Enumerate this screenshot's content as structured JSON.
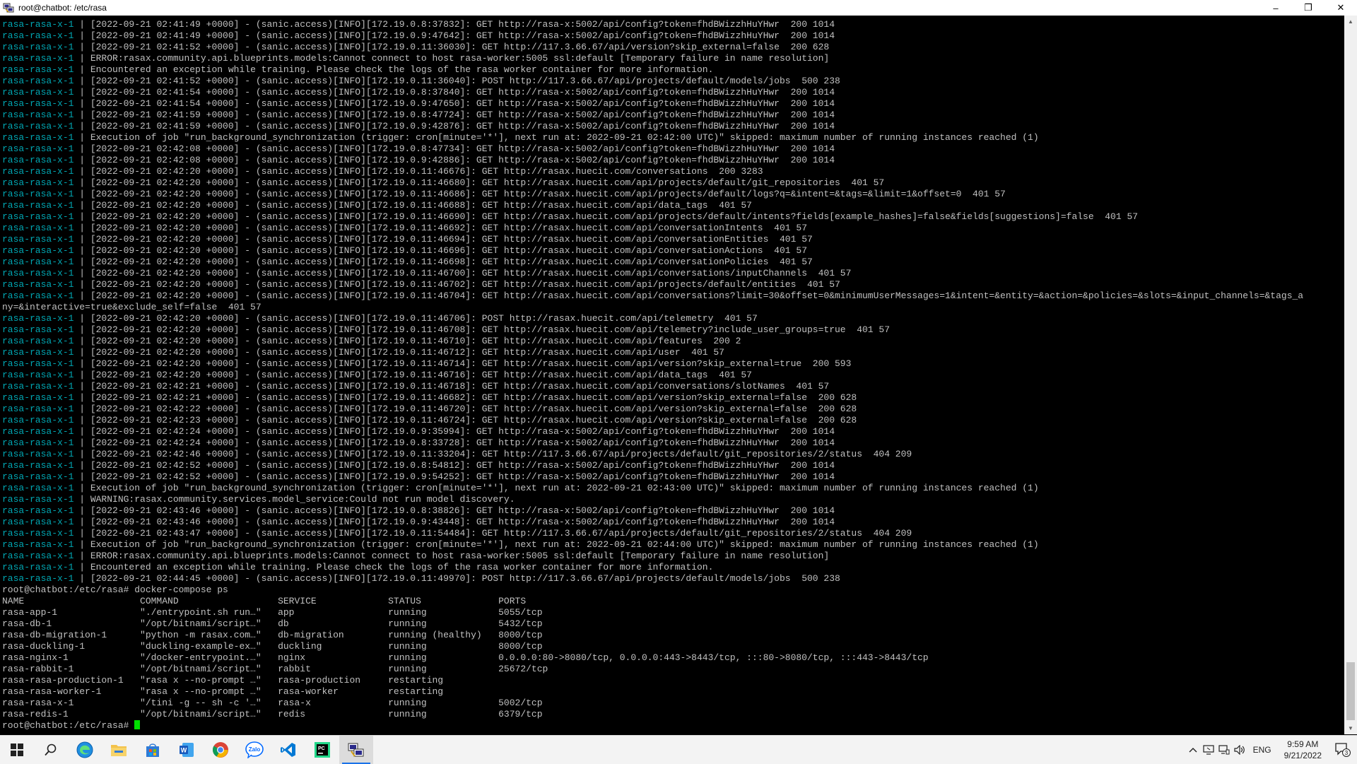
{
  "window": {
    "title": "root@chatbot: /etc/rasa",
    "controls": {
      "minimize": "–",
      "maximize": "❐",
      "close": "✕"
    }
  },
  "terminal": {
    "log_lines": [
      {
        "pfx": "rasa-rasa-x-1",
        "msg": " | [2022-09-21 02:41:49 +0000] - (sanic.access)[INFO][172.19.0.8:37832]: GET http://rasa-x:5002/api/config?token=fhdBWizzhHuYHwr  200 1014"
      },
      {
        "pfx": "rasa-rasa-x-1",
        "msg": " | [2022-09-21 02:41:49 +0000] - (sanic.access)[INFO][172.19.0.9:47642]: GET http://rasa-x:5002/api/config?token=fhdBWizzhHuYHwr  200 1014"
      },
      {
        "pfx": "rasa-rasa-x-1",
        "msg": " | [2022-09-21 02:41:52 +0000] - (sanic.access)[INFO][172.19.0.11:36030]: GET http://117.3.66.67/api/version?skip_external=false  200 628"
      },
      {
        "pfx": "rasa-rasa-x-1",
        "msg": " | ERROR:rasax.community.api.blueprints.models:Cannot connect to host rasa-worker:5005 ssl:default [Temporary failure in name resolution]"
      },
      {
        "pfx": "rasa-rasa-x-1",
        "msg": " | Encountered an exception while training. Please check the logs of the rasa worker container for more information."
      },
      {
        "pfx": "rasa-rasa-x-1",
        "msg": " | [2022-09-21 02:41:52 +0000] - (sanic.access)[INFO][172.19.0.11:36040]: POST http://117.3.66.67/api/projects/default/models/jobs  500 238"
      },
      {
        "pfx": "rasa-rasa-x-1",
        "msg": " | [2022-09-21 02:41:54 +0000] - (sanic.access)[INFO][172.19.0.8:37840]: GET http://rasa-x:5002/api/config?token=fhdBWizzhHuYHwr  200 1014"
      },
      {
        "pfx": "rasa-rasa-x-1",
        "msg": " | [2022-09-21 02:41:54 +0000] - (sanic.access)[INFO][172.19.0.9:47650]: GET http://rasa-x:5002/api/config?token=fhdBWizzhHuYHwr  200 1014"
      },
      {
        "pfx": "rasa-rasa-x-1",
        "msg": " | [2022-09-21 02:41:59 +0000] - (sanic.access)[INFO][172.19.0.8:47724]: GET http://rasa-x:5002/api/config?token=fhdBWizzhHuYHwr  200 1014"
      },
      {
        "pfx": "rasa-rasa-x-1",
        "msg": " | [2022-09-21 02:41:59 +0000] - (sanic.access)[INFO][172.19.0.9:42876]: GET http://rasa-x:5002/api/config?token=fhdBWizzhHuYHwr  200 1014"
      },
      {
        "pfx": "rasa-rasa-x-1",
        "msg": " | Execution of job \"run_background_synchronization (trigger: cron[minute='*'], next run at: 2022-09-21 02:42:00 UTC)\" skipped: maximum number of running instances reached (1)"
      },
      {
        "pfx": "rasa-rasa-x-1",
        "msg": " | [2022-09-21 02:42:08 +0000] - (sanic.access)[INFO][172.19.0.8:47734]: GET http://rasa-x:5002/api/config?token=fhdBWizzhHuYHwr  200 1014"
      },
      {
        "pfx": "rasa-rasa-x-1",
        "msg": " | [2022-09-21 02:42:08 +0000] - (sanic.access)[INFO][172.19.0.9:42886]: GET http://rasa-x:5002/api/config?token=fhdBWizzhHuYHwr  200 1014"
      },
      {
        "pfx": "rasa-rasa-x-1",
        "msg": " | [2022-09-21 02:42:20 +0000] - (sanic.access)[INFO][172.19.0.11:46676]: GET http://rasax.huecit.com/conversations  200 3283"
      },
      {
        "pfx": "rasa-rasa-x-1",
        "msg": " | [2022-09-21 02:42:20 +0000] - (sanic.access)[INFO][172.19.0.11:46680]: GET http://rasax.huecit.com/api/projects/default/git_repositories  401 57"
      },
      {
        "pfx": "rasa-rasa-x-1",
        "msg": " | [2022-09-21 02:42:20 +0000] - (sanic.access)[INFO][172.19.0.11:46686]: GET http://rasax.huecit.com/api/projects/default/logs?q=&intent=&tags=&limit=1&offset=0  401 57"
      },
      {
        "pfx": "rasa-rasa-x-1",
        "msg": " | [2022-09-21 02:42:20 +0000] - (sanic.access)[INFO][172.19.0.11:46688]: GET http://rasax.huecit.com/api/data_tags  401 57"
      },
      {
        "pfx": "rasa-rasa-x-1",
        "msg": " | [2022-09-21 02:42:20 +0000] - (sanic.access)[INFO][172.19.0.11:46690]: GET http://rasax.huecit.com/api/projects/default/intents?fields[example_hashes]=false&fields[suggestions]=false  401 57"
      },
      {
        "pfx": "rasa-rasa-x-1",
        "msg": " | [2022-09-21 02:42:20 +0000] - (sanic.access)[INFO][172.19.0.11:46692]: GET http://rasax.huecit.com/api/conversationIntents  401 57"
      },
      {
        "pfx": "rasa-rasa-x-1",
        "msg": " | [2022-09-21 02:42:20 +0000] - (sanic.access)[INFO][172.19.0.11:46694]: GET http://rasax.huecit.com/api/conversationEntities  401 57"
      },
      {
        "pfx": "rasa-rasa-x-1",
        "msg": " | [2022-09-21 02:42:20 +0000] - (sanic.access)[INFO][172.19.0.11:46696]: GET http://rasax.huecit.com/api/conversationActions  401 57"
      },
      {
        "pfx": "rasa-rasa-x-1",
        "msg": " | [2022-09-21 02:42:20 +0000] - (sanic.access)[INFO][172.19.0.11:46698]: GET http://rasax.huecit.com/api/conversationPolicies  401 57"
      },
      {
        "pfx": "rasa-rasa-x-1",
        "msg": " | [2022-09-21 02:42:20 +0000] - (sanic.access)[INFO][172.19.0.11:46700]: GET http://rasax.huecit.com/api/conversations/inputChannels  401 57"
      },
      {
        "pfx": "rasa-rasa-x-1",
        "msg": " | [2022-09-21 02:42:20 +0000] - (sanic.access)[INFO][172.19.0.11:46702]: GET http://rasax.huecit.com/api/projects/default/entities  401 57"
      },
      {
        "pfx": "rasa-rasa-x-1",
        "msg": " | [2022-09-21 02:42:20 +0000] - (sanic.access)[INFO][172.19.0.11:46704]: GET http://rasax.huecit.com/api/conversations?limit=30&offset=0&minimumUserMessages=1&intent=&entity=&action=&policies=&slots=&input_channels=&tags_a"
      },
      {
        "pfx": "",
        "msg": "ny=&interactive=true&exclude_self=false  401 57"
      },
      {
        "pfx": "rasa-rasa-x-1",
        "msg": " | [2022-09-21 02:42:20 +0000] - (sanic.access)[INFO][172.19.0.11:46706]: POST http://rasax.huecit.com/api/telemetry  401 57"
      },
      {
        "pfx": "rasa-rasa-x-1",
        "msg": " | [2022-09-21 02:42:20 +0000] - (sanic.access)[INFO][172.19.0.11:46708]: GET http://rasax.huecit.com/api/telemetry?include_user_groups=true  401 57"
      },
      {
        "pfx": "rasa-rasa-x-1",
        "msg": " | [2022-09-21 02:42:20 +0000] - (sanic.access)[INFO][172.19.0.11:46710]: GET http://rasax.huecit.com/api/features  200 2"
      },
      {
        "pfx": "rasa-rasa-x-1",
        "msg": " | [2022-09-21 02:42:20 +0000] - (sanic.access)[INFO][172.19.0.11:46712]: GET http://rasax.huecit.com/api/user  401 57"
      },
      {
        "pfx": "rasa-rasa-x-1",
        "msg": " | [2022-09-21 02:42:20 +0000] - (sanic.access)[INFO][172.19.0.11:46714]: GET http://rasax.huecit.com/api/version?skip_external=true  200 593"
      },
      {
        "pfx": "rasa-rasa-x-1",
        "msg": " | [2022-09-21 02:42:20 +0000] - (sanic.access)[INFO][172.19.0.11:46716]: GET http://rasax.huecit.com/api/data_tags  401 57"
      },
      {
        "pfx": "rasa-rasa-x-1",
        "msg": " | [2022-09-21 02:42:21 +0000] - (sanic.access)[INFO][172.19.0.11:46718]: GET http://rasax.huecit.com/api/conversations/slotNames  401 57"
      },
      {
        "pfx": "rasa-rasa-x-1",
        "msg": " | [2022-09-21 02:42:21 +0000] - (sanic.access)[INFO][172.19.0.11:46682]: GET http://rasax.huecit.com/api/version?skip_external=false  200 628"
      },
      {
        "pfx": "rasa-rasa-x-1",
        "msg": " | [2022-09-21 02:42:22 +0000] - (sanic.access)[INFO][172.19.0.11:46720]: GET http://rasax.huecit.com/api/version?skip_external=false  200 628"
      },
      {
        "pfx": "rasa-rasa-x-1",
        "msg": " | [2022-09-21 02:42:23 +0000] - (sanic.access)[INFO][172.19.0.11:46724]: GET http://rasax.huecit.com/api/version?skip_external=false  200 628"
      },
      {
        "pfx": "rasa-rasa-x-1",
        "msg": " | [2022-09-21 02:42:24 +0000] - (sanic.access)[INFO][172.19.0.9:35994]: GET http://rasa-x:5002/api/config?token=fhdBWizzhHuYHwr  200 1014"
      },
      {
        "pfx": "rasa-rasa-x-1",
        "msg": " | [2022-09-21 02:42:24 +0000] - (sanic.access)[INFO][172.19.0.8:33728]: GET http://rasa-x:5002/api/config?token=fhdBWizzhHuYHwr  200 1014"
      },
      {
        "pfx": "rasa-rasa-x-1",
        "msg": " | [2022-09-21 02:42:46 +0000] - (sanic.access)[INFO][172.19.0.11:33204]: GET http://117.3.66.67/api/projects/default/git_repositories/2/status  404 209"
      },
      {
        "pfx": "rasa-rasa-x-1",
        "msg": " | [2022-09-21 02:42:52 +0000] - (sanic.access)[INFO][172.19.0.8:54812]: GET http://rasa-x:5002/api/config?token=fhdBWizzhHuYHwr  200 1014"
      },
      {
        "pfx": "rasa-rasa-x-1",
        "msg": " | [2022-09-21 02:42:52 +0000] - (sanic.access)[INFO][172.19.0.9:54252]: GET http://rasa-x:5002/api/config?token=fhdBWizzhHuYHwr  200 1014"
      },
      {
        "pfx": "rasa-rasa-x-1",
        "msg": " | Execution of job \"run_background_synchronization (trigger: cron[minute='*'], next run at: 2022-09-21 02:43:00 UTC)\" skipped: maximum number of running instances reached (1)"
      },
      {
        "pfx": "rasa-rasa-x-1",
        "msg": " | WARNING:rasax.community.services.model_service:Could not run model discovery."
      },
      {
        "pfx": "rasa-rasa-x-1",
        "msg": " | [2022-09-21 02:43:46 +0000] - (sanic.access)[INFO][172.19.0.8:38826]: GET http://rasa-x:5002/api/config?token=fhdBWizzhHuYHwr  200 1014"
      },
      {
        "pfx": "rasa-rasa-x-1",
        "msg": " | [2022-09-21 02:43:46 +0000] - (sanic.access)[INFO][172.19.0.9:43448]: GET http://rasa-x:5002/api/config?token=fhdBWizzhHuYHwr  200 1014"
      },
      {
        "pfx": "rasa-rasa-x-1",
        "msg": " | [2022-09-21 02:43:47 +0000] - (sanic.access)[INFO][172.19.0.11:54484]: GET http://117.3.66.67/api/projects/default/git_repositories/2/status  404 209"
      },
      {
        "pfx": "rasa-rasa-x-1",
        "msg": " | Execution of job \"run_background_synchronization (trigger: cron[minute='*'], next run at: 2022-09-21 02:44:00 UTC)\" skipped: maximum number of running instances reached (1)"
      },
      {
        "pfx": "rasa-rasa-x-1",
        "msg": " | ERROR:rasax.community.api.blueprints.models:Cannot connect to host rasa-worker:5005 ssl:default [Temporary failure in name resolution]"
      },
      {
        "pfx": "rasa-rasa-x-1",
        "msg": " | Encountered an exception while training. Please check the logs of the rasa worker container for more information."
      },
      {
        "pfx": "rasa-rasa-x-1",
        "msg": " | [2022-09-21 02:44:45 +0000] - (sanic.access)[INFO][172.19.0.11:49970]: POST http://117.3.66.67/api/projects/default/models/jobs  500 238"
      }
    ],
    "command_line": "root@chatbot:/etc/rasa# docker-compose ps",
    "ps_header": "NAME                     COMMAND                  SERVICE             STATUS              PORTS",
    "ps_rows": [
      "rasa-app-1               \"./entrypoint.sh run…\"   app                 running             5055/tcp",
      "rasa-db-1                \"/opt/bitnami/script…\"   db                  running             5432/tcp",
      "rasa-db-migration-1      \"python -m rasax.com…\"   db-migration        running (healthy)   8000/tcp",
      "rasa-duckling-1          \"duckling-example-ex…\"   duckling            running             8000/tcp",
      "rasa-nginx-1             \"/docker-entrypoint.…\"   nginx               running             0.0.0.0:80->8080/tcp, 0.0.0.0:443->8443/tcp, :::80->8080/tcp, :::443->8443/tcp",
      "rasa-rabbit-1            \"/opt/bitnami/script…\"   rabbit              running             25672/tcp",
      "rasa-rasa-production-1   \"rasa x --no-prompt …\"   rasa-production     restarting",
      "rasa-rasa-worker-1       \"rasa x --no-prompt …\"   rasa-worker         restarting",
      "rasa-rasa-x-1            \"/tini -g -- sh -c '…\"   rasa-x              running             5002/tcp",
      "rasa-redis-1             \"/opt/bitnami/script…\"   redis               running             6379/tcp"
    ],
    "prompt": "root@chatbot:/etc/rasa# "
  },
  "taskbar": {
    "apps": [
      "start-icon",
      "search-icon",
      "edge-icon",
      "file-explorer-icon",
      "store-icon",
      "word-icon",
      "chrome-icon",
      "zalo-icon",
      "vscode-icon",
      "pycharm-icon",
      "putty-icon"
    ],
    "zalo_label": "Zalo",
    "lang": "ENG",
    "time": "9:59 AM",
    "date": "9/21/2022",
    "notif_count": "3"
  },
  "colors": {
    "prefix": "#00a6b2",
    "text": "#c0c0c0",
    "cursor": "#00e000"
  }
}
